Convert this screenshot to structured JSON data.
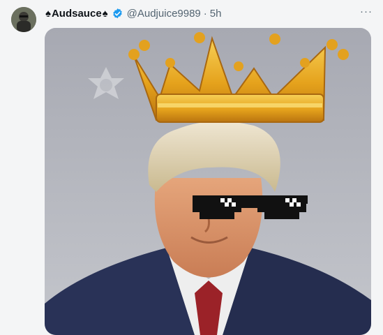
{
  "post": {
    "display_name": "Audsauce",
    "name_prefix_glyph": "♠",
    "name_suffix_glyph": "♠",
    "handle": "@Audjuice9989",
    "separator": "·",
    "timestamp": "5h",
    "more_glyph": "···"
  },
  "media": {
    "alt": "Edited mugshot with a gold crown and pixelated sunglasses"
  },
  "colors": {
    "verified_blue": "#1d9bf0",
    "background": "#f4f5f6",
    "muted_text": "#536471"
  },
  "icons": {
    "verified": "verified-badge-icon",
    "more": "more-options-icon"
  }
}
